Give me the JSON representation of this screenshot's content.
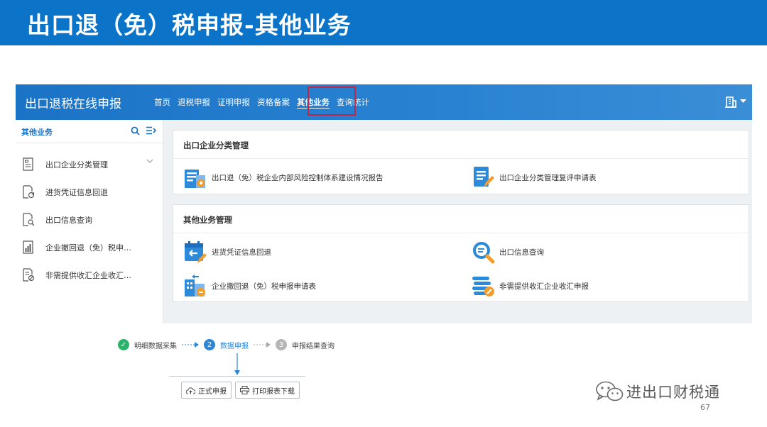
{
  "slide": {
    "title": "出口退（免）税申报-其他业务",
    "page_number": "67",
    "watermark": "进出口财税通"
  },
  "app": {
    "title": "出口退税在线申报",
    "nav": [
      {
        "label": "首页"
      },
      {
        "label": "退税申报"
      },
      {
        "label": "证明申报"
      },
      {
        "label": "资格备案"
      },
      {
        "label": "其他业务",
        "active": true
      },
      {
        "label": "查询统计"
      }
    ],
    "user_icon": "building-icon"
  },
  "sidebar": {
    "title": "其他业务",
    "items": [
      {
        "label": "出口企业分类管理",
        "icon": "document-list-icon"
      },
      {
        "label": "进货凭证信息回退",
        "icon": "document-refresh-icon"
      },
      {
        "label": "出口信息查询",
        "icon": "document-search-icon"
      },
      {
        "label": "企业撤回退（免）税申…",
        "icon": "document-chart-icon"
      },
      {
        "label": "非需提供收汇企业收汇…",
        "icon": "document-cancel-icon"
      }
    ]
  },
  "cards": [
    {
      "title": "出口企业分类管理",
      "items": [
        {
          "label": "出口退（免）税企业内部风险控制体系建设情况报告",
          "icon": "risk-report-icon"
        },
        {
          "label": "出口企业分类管理复评申请表",
          "icon": "form-edit-icon"
        }
      ]
    },
    {
      "title": "其他业务管理",
      "items": [
        {
          "label": "进货凭证信息回退",
          "icon": "calendar-return-icon"
        },
        {
          "label": "出口信息查询",
          "icon": "magnifier-icon"
        },
        {
          "label": "企业撤回退（免）税申报申请表",
          "icon": "enterprise-withdraw-icon"
        },
        {
          "label": "非需提供收汇企业收汇申报",
          "icon": "coin-stack-icon"
        }
      ]
    }
  ],
  "steps": [
    {
      "label": "明细数据采集",
      "badge": "✓",
      "state": "done"
    },
    {
      "label": "数据申报",
      "badge": "2",
      "state": "active"
    },
    {
      "label": "申报结果查询",
      "badge": "3",
      "state": "pending"
    }
  ],
  "buttons": {
    "formal_declare": "正式申报",
    "print_download": "打印报表下载"
  },
  "colors": {
    "brand_blue": "#0b74c9",
    "highlight_red": "#c0254a",
    "done_green": "#2cb36b",
    "step_active": "#2b86d6",
    "step_pending": "#b5b5b5",
    "icon_orange": "#f39c2b"
  }
}
